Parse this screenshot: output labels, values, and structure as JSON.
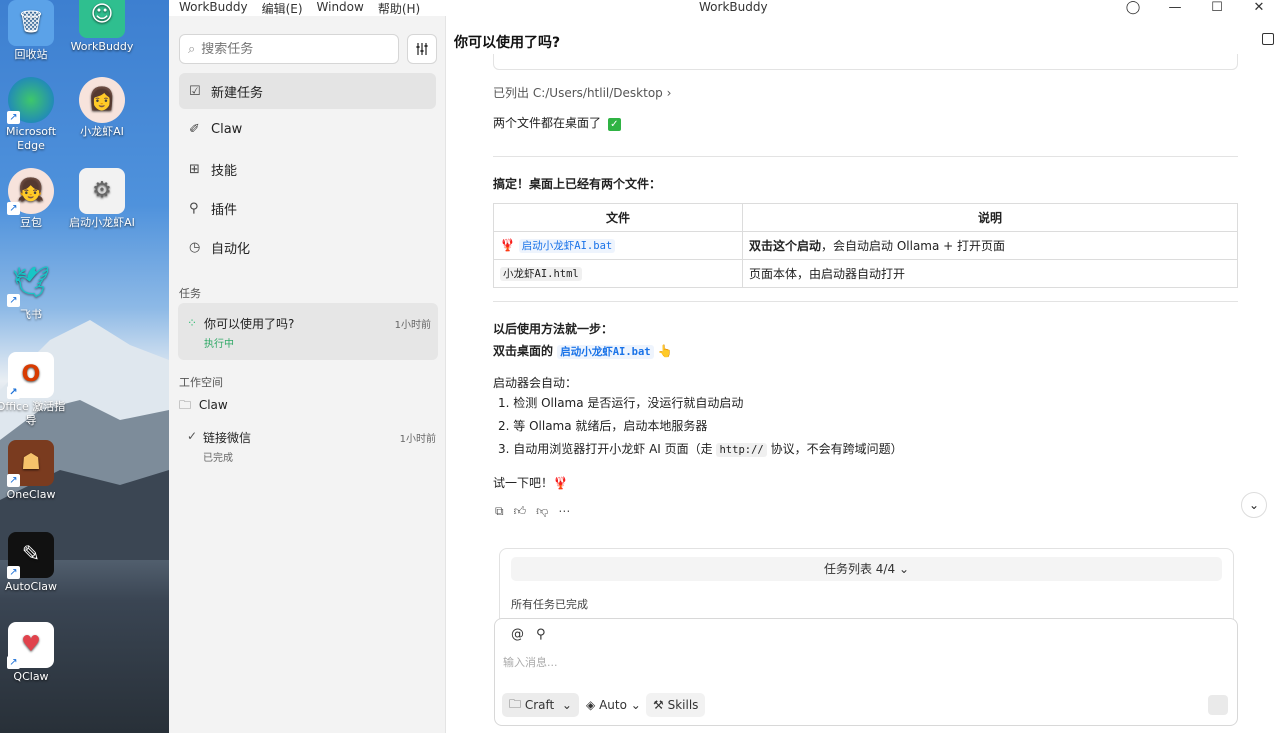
{
  "desktop": {
    "icons": [
      {
        "label": "回收站",
        "icon": "recycle-bin-icon"
      },
      {
        "label": "WorkBuddy",
        "icon": "workbuddy-icon"
      },
      {
        "label": "Microsoft Edge",
        "icon": "edge-icon"
      },
      {
        "label": "小龙虾AI",
        "icon": "avatar-icon"
      },
      {
        "label": "豆包",
        "icon": "doubao-icon"
      },
      {
        "label": "启动小龙虾AI",
        "icon": "gear-icon"
      },
      {
        "label": "飞书",
        "icon": "feishu-icon"
      },
      {
        "label": "Office 激活指导",
        "icon": "office-icon"
      },
      {
        "label": "OneClaw",
        "icon": "oneclaw-icon"
      },
      {
        "label": "AutoClaw",
        "icon": "autoclaw-icon"
      },
      {
        "label": "QClaw",
        "icon": "qclaw-icon"
      }
    ]
  },
  "titlebar": {
    "menu": [
      "WorkBuddy",
      "编辑(E)",
      "Window",
      "帮助(H)"
    ],
    "title": "WorkBuddy"
  },
  "sidebar": {
    "search_placeholder": "搜索任务",
    "nav": [
      {
        "label": "新建任务",
        "icon": "edit-icon"
      },
      {
        "label": "Claw",
        "icon": "claw-icon"
      },
      {
        "label": "技能",
        "icon": "grid-icon"
      },
      {
        "label": "插件",
        "icon": "plug-icon"
      },
      {
        "label": "自动化",
        "icon": "clock-icon"
      }
    ],
    "tasks_label": "任务",
    "task": {
      "title": "你可以使用了吗?",
      "time": "1小时前",
      "status": "执行中"
    },
    "workspace_label": "工作空间",
    "workspace": "Claw",
    "done_task": {
      "title": "链接微信",
      "time": "1小时前",
      "status": "已完成"
    }
  },
  "main": {
    "title": "你可以使用了吗?",
    "listed_prefix": "已列出",
    "listed_path": "C:/Users/htlil/Desktop",
    "both_files": "两个文件都在桌面了",
    "done_heading": "搞定！桌面上已经有两个文件：",
    "table": {
      "headers": [
        "文件",
        "说明"
      ],
      "rows": [
        {
          "file": "启动小龙虾AI.bat",
          "desc_bold": "双击这个启动",
          "desc": "，会自动启动 Ollama + 打开页面"
        },
        {
          "file": "小龙虾AI.html",
          "desc_bold": "",
          "desc": "页面本体，由启动器自动打开"
        }
      ]
    },
    "usage_heading": "以后使用方法就一步：",
    "usage_prefix": "双击桌面的",
    "usage_file": "启动小龙虾AI.bat",
    "auto_label": "启动器会自动：",
    "steps": [
      "检测 Ollama 是否运行，没运行就自动启动",
      "等 Ollama 就绪后，启动本地服务器"
    ],
    "step3_prefix": "自动用浏览器打开小龙虾 AI 页面（走",
    "step3_code": "http://",
    "step3_suffix": "协议，不会有跨域问题）",
    "try": "试一下吧！"
  },
  "tasklist": {
    "label": "任务列表 4/4",
    "status": "所有任务已完成"
  },
  "composer": {
    "placeholder": "输入消息...",
    "mode": "Craft",
    "model": "Auto",
    "skills": "Skills"
  }
}
